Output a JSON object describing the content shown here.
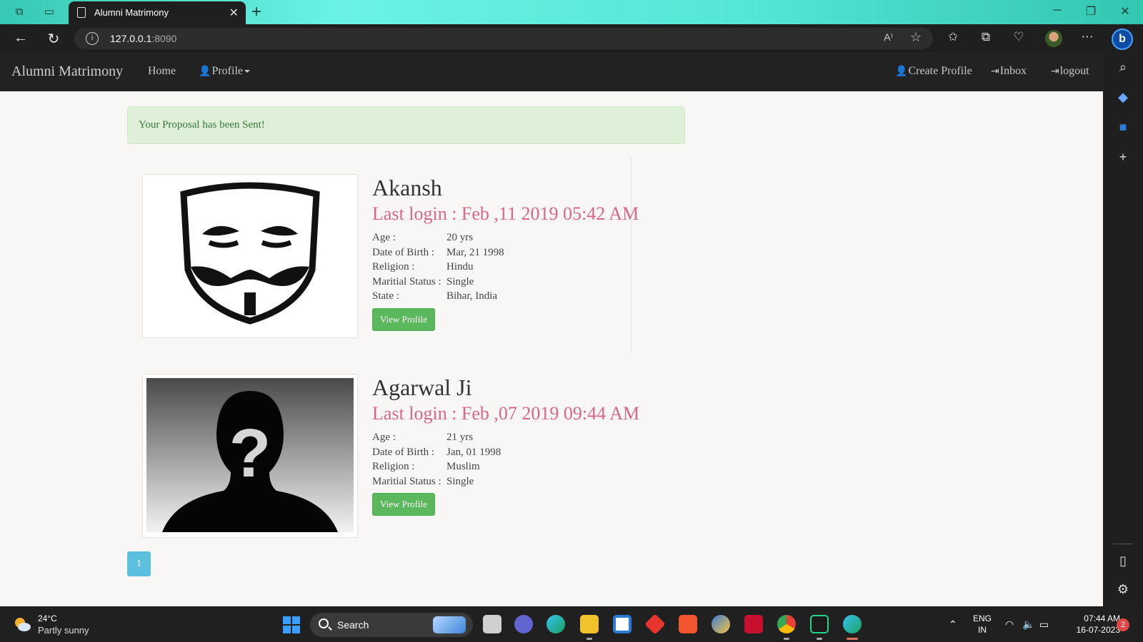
{
  "browser": {
    "tab_title": "Alumni Matrimony",
    "url_host": "127.0.0.1",
    "url_port": ":8090"
  },
  "navbar": {
    "brand": "Alumni Matrimony",
    "home": "Home",
    "profile": "Profile",
    "create_profile": "Create Profile",
    "inbox": "Inbox",
    "logout": "logout"
  },
  "alert": "Your Proposal has been Sent!",
  "profiles": [
    {
      "name": "Akansh",
      "last_login": "Last login : Feb ,11 2019 05:42 AM",
      "attrs": [
        {
          "label": "Age :",
          "value": "20 yrs"
        },
        {
          "label": "Date of Birth :",
          "value": "Mar, 21 1998"
        },
        {
          "label": "Religion :",
          "value": "Hindu"
        },
        {
          "label": "Maritial Status :",
          "value": "Single"
        },
        {
          "label": "State :",
          "value": "Bihar, India"
        }
      ],
      "button": "View Profile"
    },
    {
      "name": "Agarwal Ji",
      "last_login": "Last login : Feb ,07 2019 09:44 AM",
      "attrs": [
        {
          "label": "Age :",
          "value": "21 yrs"
        },
        {
          "label": "Date of Birth :",
          "value": "Jan, 01 1998"
        },
        {
          "label": "Religion :",
          "value": "Muslim"
        },
        {
          "label": "Maritial Status :",
          "value": "Single"
        }
      ],
      "button": "View Profile"
    }
  ],
  "pagination": {
    "current": "1"
  },
  "taskbar": {
    "temperature": "24°C",
    "condition": "Partly sunny",
    "search": "Search",
    "lang_1": "ENG",
    "lang_2": "IN",
    "time": "07:44 AM",
    "date": "16-07-2023",
    "notifications": "2"
  }
}
